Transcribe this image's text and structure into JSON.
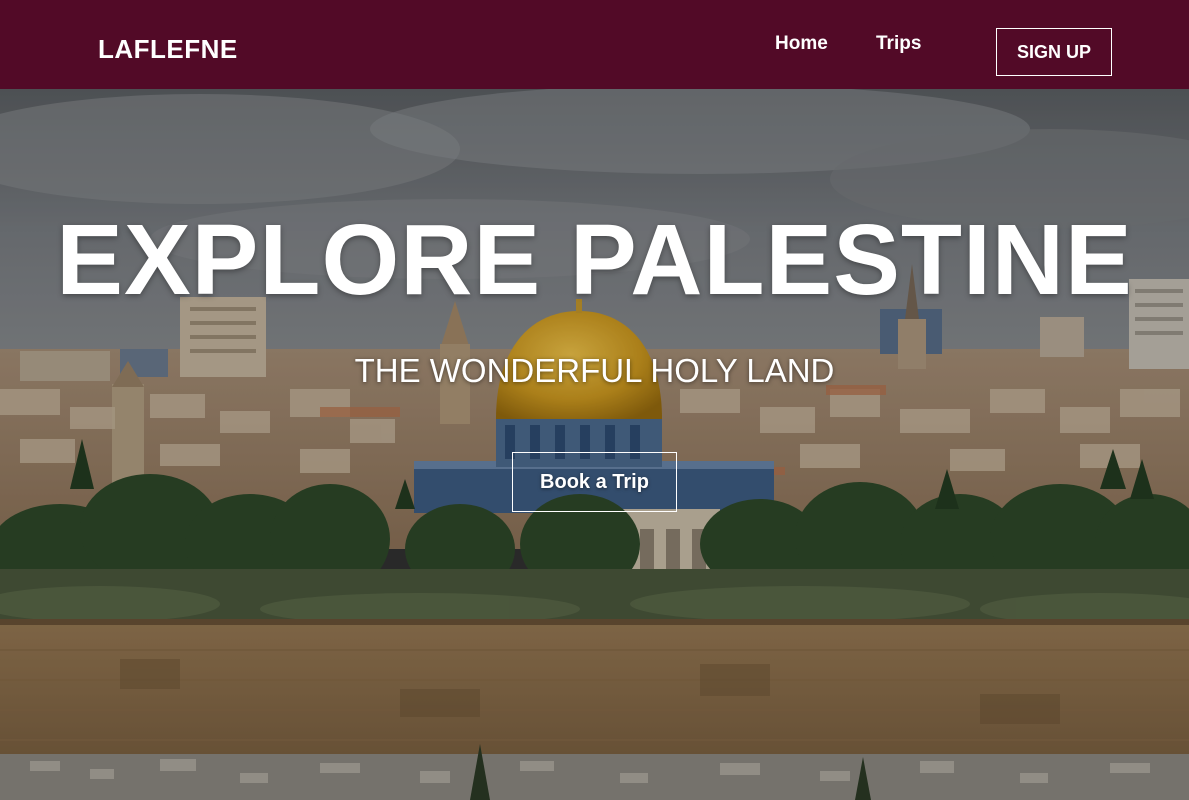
{
  "navbar": {
    "brand": "LAFLEFNE",
    "links": [
      {
        "label": "Home"
      },
      {
        "label": "Trips"
      }
    ],
    "signup_label": "SIGN UP",
    "background": "#520a27"
  },
  "hero": {
    "title": "EXPLORE PALESTINE",
    "subtitle": "THE WONDERFUL HOLY LAND",
    "cta_label": "Book a Trip",
    "background_image": "jerusalem-dome-of-the-rock-cityscape"
  }
}
